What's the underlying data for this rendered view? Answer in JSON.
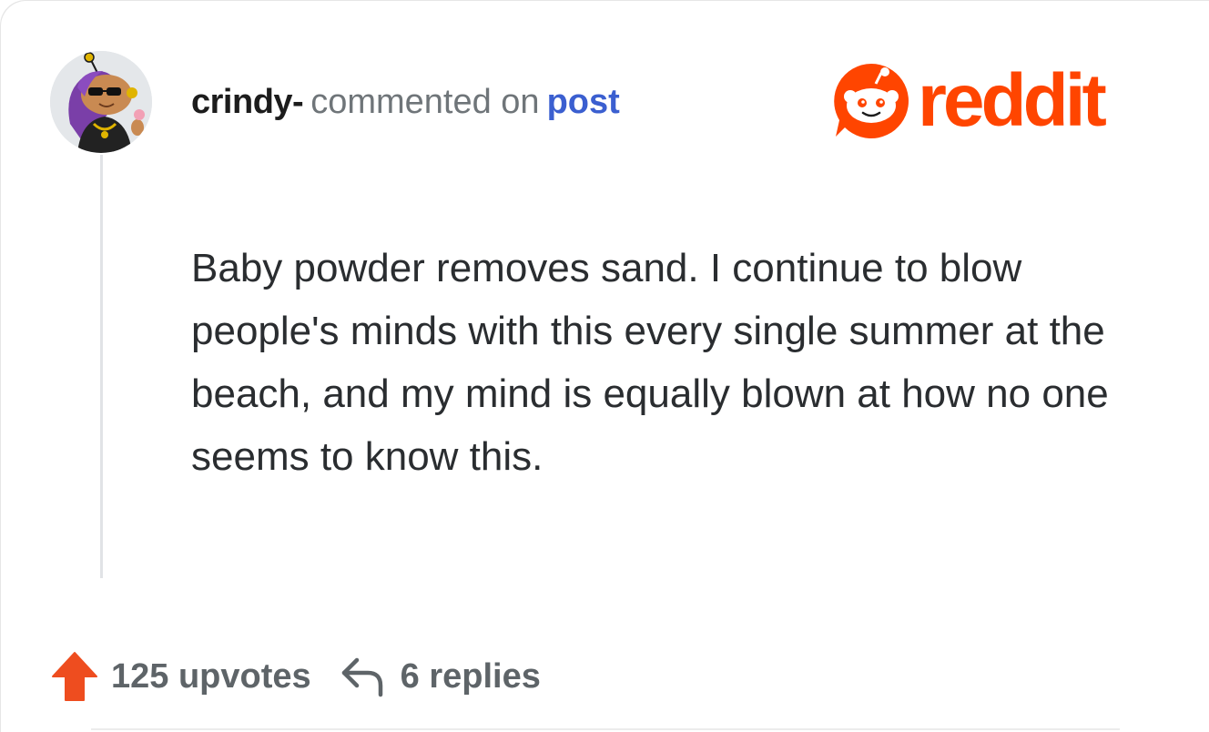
{
  "comment": {
    "username": "crindy-",
    "action_text": "commented on",
    "post_link": "post",
    "body": "Baby powder removes sand. I continue to blow people's minds with this every single summer at the beach, and my mind is equally blown at how no one seems to know this."
  },
  "brand": {
    "logo_text": "reddit",
    "color": "#ff4500"
  },
  "footer": {
    "upvotes_label": "125 upvotes",
    "replies_label": "6 replies",
    "upvote_icon": "arrow-up-icon",
    "reply_icon": "reply-arrow-icon"
  },
  "colors": {
    "username": "#1c1c1c",
    "secondary_text": "#6f7579",
    "link": "#3b5fd0",
    "body_text": "#2a2d30",
    "upvote": "#ee4d1f"
  }
}
